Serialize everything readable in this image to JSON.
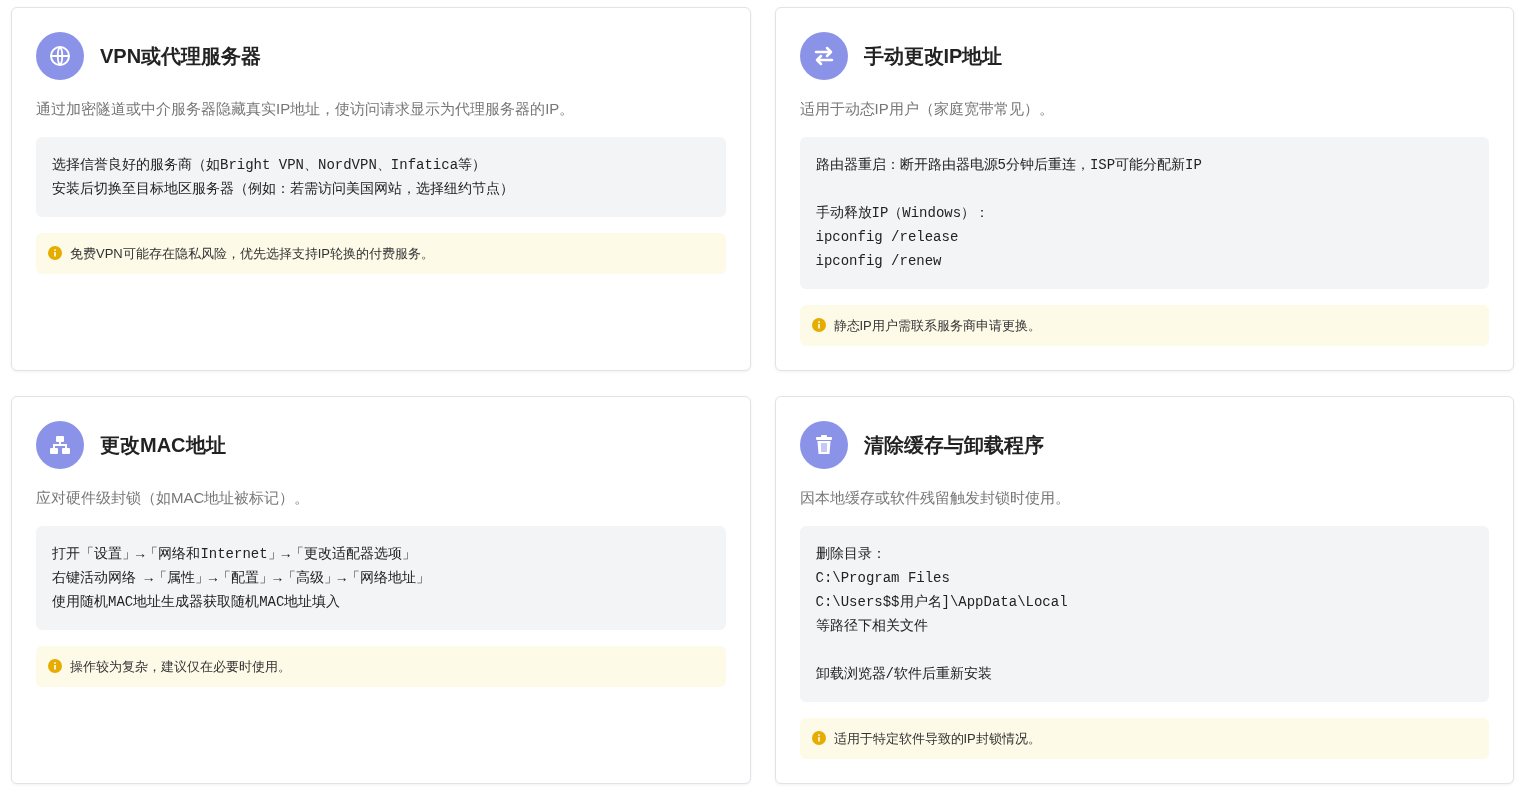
{
  "cards": [
    {
      "kind": "globe",
      "title": "VPN或代理服务器",
      "description": "通过加密隧道或中介服务器隐藏真实IP地址，使访问请求显示为代理服务器的IP。",
      "steps": [
        [
          "选择信誉良好的服务商（如Bright VPN、NordVPN、Infatica等）",
          "安装后切换至目标地区服务器（例如：若需访问美国网站，选择纽约节点）"
        ]
      ],
      "note": "免费VPN可能存在隐私风险，优先选择支持IP轮换的付费服务。"
    },
    {
      "kind": "swap",
      "title": "手动更改IP地址",
      "description": "适用于动态IP用户（家庭宽带常见）。",
      "steps": [
        [
          "路由器重启：断开路由器电源5分钟后重连，ISP可能分配新IP"
        ],
        [
          "手动释放IP（Windows）：",
          "ipconfig /release",
          "ipconfig /renew"
        ]
      ],
      "note": "静态IP用户需联系服务商申请更换。"
    },
    {
      "kind": "network",
      "title": "更改MAC地址",
      "description": "应对硬件级封锁（如MAC地址被标记）。",
      "steps": [
        [
          "打开「设置」→「网络和Internet」→「更改适配器选项」",
          "右键活动网络 →「属性」→「配置」→「高级」→「网络地址」",
          "使用随机MAC地址生成器获取随机MAC地址填入"
        ]
      ],
      "note": "操作较为复杂，建议仅在必要时使用。"
    },
    {
      "kind": "trash",
      "title": "清除缓存与卸载程序",
      "description": "因本地缓存或软件残留触发封锁时使用。",
      "steps": [
        [
          "删除目录：",
          "C:\\Program Files",
          "C:\\Users$$用户名]\\AppData\\Local",
          "等路径下相关文件"
        ],
        [
          "卸载浏览器/软件后重新安装"
        ]
      ],
      "note": "适用于特定软件导致的IP封锁情况。"
    }
  ]
}
